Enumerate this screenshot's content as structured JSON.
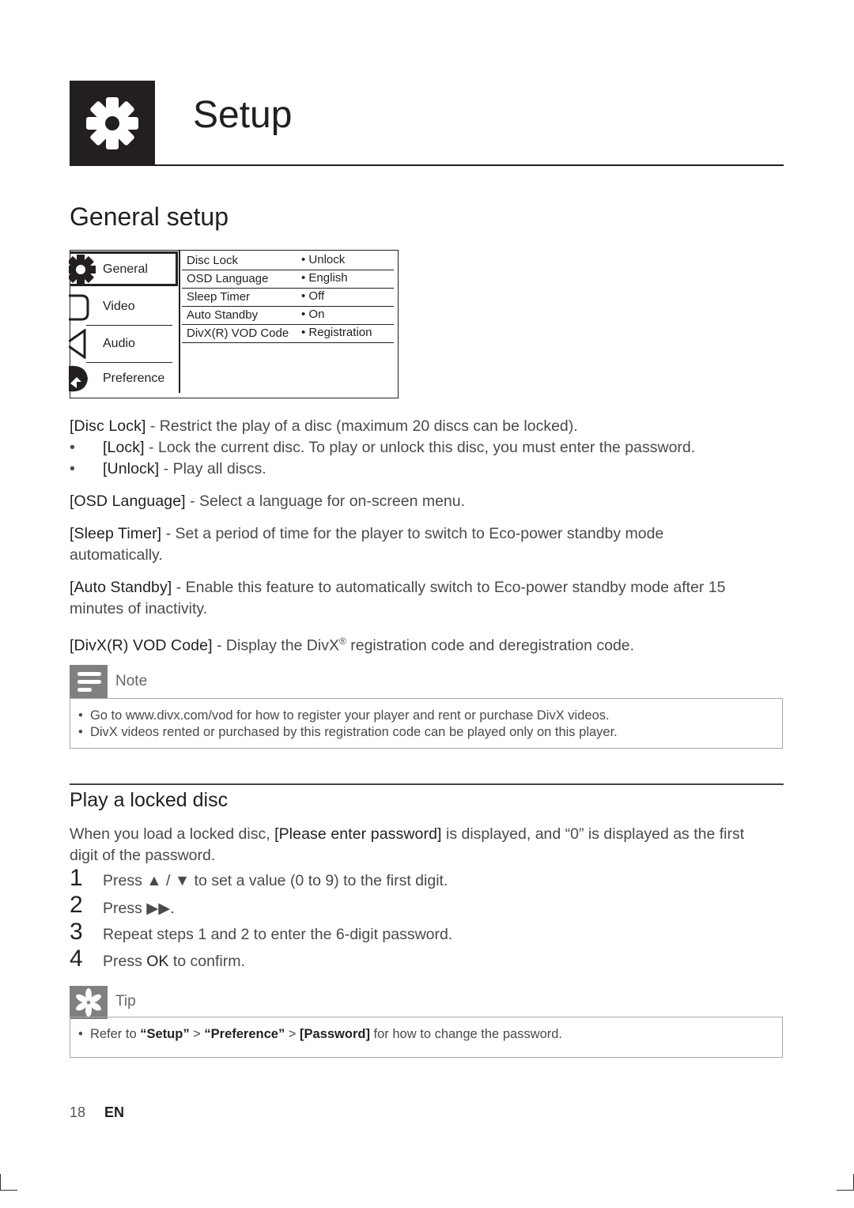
{
  "chapter": {
    "title": "Setup",
    "icon": "gear-icon"
  },
  "section": {
    "title": "General setup"
  },
  "menu": {
    "tabs": [
      {
        "label": "General",
        "icon": "gear-icon",
        "active": true
      },
      {
        "label": "Video",
        "icon": "video-icon",
        "active": false
      },
      {
        "label": "Audio",
        "icon": "speaker-icon",
        "active": false
      },
      {
        "label": "Preference",
        "icon": "preference-icon",
        "active": false
      }
    ],
    "options": [
      {
        "key": "Disc Lock",
        "value": "• Unlock"
      },
      {
        "key": "OSD Language",
        "value": "• English"
      },
      {
        "key": "Sleep Timer",
        "value": "• Off"
      },
      {
        "key": "Auto Standby",
        "value": "• On"
      },
      {
        "key": "DivX(R) VOD Code",
        "value": "• Registration"
      }
    ]
  },
  "descriptions": {
    "disc_lock": {
      "term": "[Disc Lock]",
      "text": " - Restrict the play of a disc (maximum 20 discs can be locked)."
    },
    "disc_lock_items": [
      {
        "bullet": "•",
        "term": "[Lock]",
        "text": " - Lock the current disc. To play or unlock this disc, you must enter the password."
      },
      {
        "bullet": "•",
        "term": "[Unlock]",
        "text": " - Play all discs."
      }
    ],
    "osd_language": {
      "term": "[OSD Language]",
      "text": " - Select a language for on-screen menu."
    },
    "sleep_timer": {
      "term": "[Sleep Timer]",
      "text": " - Set a period of time for the player to switch to Eco-power standby mode automatically."
    },
    "auto_standby": {
      "term": "[Auto Standby]",
      "text": " - Enable this feature to automatically switch to Eco-power standby mode after 15 minutes of inactivity."
    },
    "divx_code": {
      "term": "[DivX(R) VOD Code]",
      "text_before": " - Display the DivX",
      "sup": "®",
      "text_after": " registration code and deregistration code."
    }
  },
  "note": {
    "label": "Note",
    "items": [
      "Go to www.divx.com/vod for how to register your player and rent or purchase DivX videos.",
      "DivX videos rented or purchased by this registration code can be played only on this player."
    ]
  },
  "locked_disc": {
    "title": "Play a locked disc",
    "intro_before": "When you load a locked disc, ",
    "intro_term": "[Please enter password]",
    "intro_after": " is displayed, and “0” is displayed as the first digit of the password.",
    "steps": [
      {
        "num": "1",
        "before": "Press ▲ / ▼ to set a value (0 to 9) to the first digit.",
        "term": "",
        "after": ""
      },
      {
        "num": "2",
        "before": "Press ▶▶.",
        "term": "",
        "after": ""
      },
      {
        "num": "3",
        "before": "Repeat steps 1 and 2 to enter the 6-digit password.",
        "term": "",
        "after": ""
      },
      {
        "num": "4",
        "before": "Press ",
        "term": "OK",
        "after": " to confirm."
      }
    ]
  },
  "tip": {
    "label": "Tip",
    "item_before": "Refer to ",
    "item_setup": "“Setup”",
    "sep1": " > ",
    "item_pref": "“Preference”",
    "sep2": " > ",
    "item_pw": "[Password]",
    "item_after": " for how to change the password."
  },
  "footer": {
    "page": "18",
    "lang": "EN"
  }
}
